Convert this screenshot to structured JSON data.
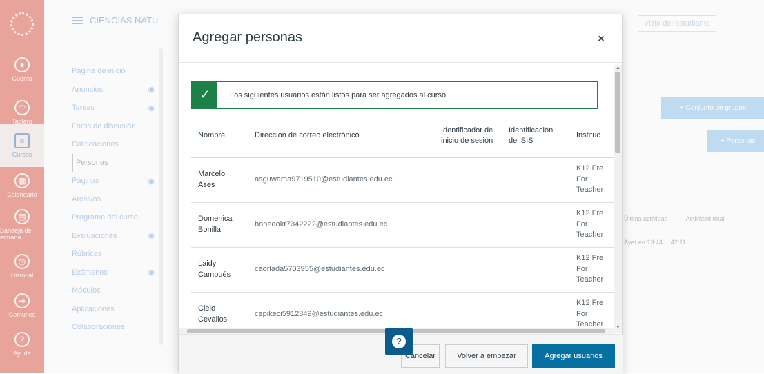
{
  "global_nav": {
    "items": [
      {
        "label": "Cuenta",
        "icon": "user-icon"
      },
      {
        "label": "Tablero",
        "icon": "dashboard-icon"
      },
      {
        "label": "Cursos",
        "icon": "book-icon"
      },
      {
        "label": "Calendario",
        "icon": "calendar-icon"
      },
      {
        "label": "Bandeja de entrada",
        "icon": "inbox-icon"
      },
      {
        "label": "Historial",
        "icon": "clock-icon"
      },
      {
        "label": "Comunes",
        "icon": "commons-icon"
      },
      {
        "label": "Ayuda",
        "icon": "help-icon"
      }
    ]
  },
  "course_header": {
    "title": "CIENCIAS NATU"
  },
  "course_nav": {
    "items": [
      "Página de inicio",
      "Anuncios",
      "Tareas",
      "Foros de discusión",
      "Calificaciones",
      "Personas",
      "Páginas",
      "Archivos",
      "Programa del curso",
      "Evaluaciones",
      "Rúbricas",
      "Exámenes",
      "Módulos",
      "Aplicaciones",
      "Colaboraciones"
    ]
  },
  "bg_page": {
    "student_view": "Vista del estudiante",
    "group_set_button": "+ Conjunto de grupos",
    "people_button": "+ Personas",
    "last_activity": "Última actividad",
    "total_activity": "Actividad total",
    "row_activity": "Ayer en 13:44",
    "row_total": "42:11"
  },
  "modal": {
    "title": "Agregar personas",
    "close": "×",
    "alert_text": "Los siguientes usuarios están listos para ser agregados al curso.",
    "columns": {
      "name": "Nombre",
      "email": "Dirección de correo electrónico",
      "login": "Identificador de inicio de sesión",
      "sis": "Identificación del SIS",
      "institution": "Instituc"
    },
    "rows": [
      {
        "name": "Marcelo Ases",
        "email": "asguwama9719510@estudiantes.edu.ec",
        "login": "",
        "sis": "",
        "institution": "K12 Fre For Teacher"
      },
      {
        "name": "Domenica Bonilla",
        "email": "bohedokr7342222@estudiantes.edu.ec",
        "login": "",
        "sis": "",
        "institution": "K12 Fre For Teacher"
      },
      {
        "name": "Laidy Campués",
        "email": "caorlada5703955@estudiantes.edu.ec",
        "login": "",
        "sis": "",
        "institution": "K12 Fre For Teacher"
      },
      {
        "name": "Cielo Cevallos",
        "email": "cepikeci5912849@estudiantes.edu.ec",
        "login": "",
        "sis": "",
        "institution": "K12 Fre For Teacher"
      }
    ],
    "footer": {
      "cancel": "Cancelar",
      "restart": "Volver a empezar",
      "add_users": "Agregar usuarios"
    }
  },
  "help_fab": {
    "label": "?"
  },
  "colors": {
    "canvas_red": "#e8a39a",
    "success_green": "#1b8146",
    "primary_blue": "#0770a3",
    "help_blue": "#0b5b8c"
  }
}
